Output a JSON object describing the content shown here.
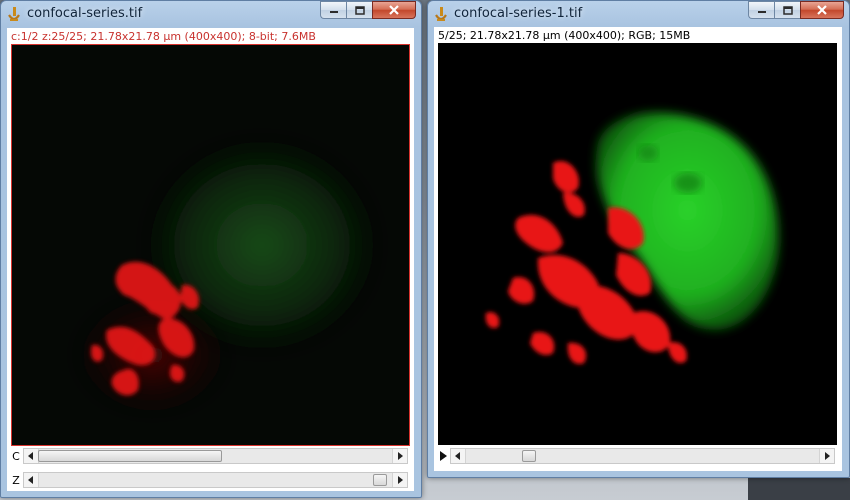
{
  "window_left": {
    "title": "confocal-series.tif",
    "info": "c:1/2 z:25/25; 21.78x21.78 µm (400x400); 8-bit; 7.6MB",
    "sliders": [
      {
        "label": "C",
        "position": 1,
        "count": 2
      },
      {
        "label": "Z",
        "position": 25,
        "count": 25
      }
    ]
  },
  "window_right": {
    "title": "confocal-series-1.tif",
    "info": "5/25; 21.78x21.78 µm (400x400); RGB; 15MB",
    "slider": {
      "position": 5,
      "count": 25
    }
  },
  "icons": {
    "app": "imagej-icon",
    "minimize": "minimize-icon",
    "maximize": "maximize-icon",
    "close": "close-icon",
    "play": "play-icon"
  },
  "colors": {
    "info_red": "#c8322e",
    "channel_red": "#ff1a1a",
    "channel_green": "#22cc22",
    "titlebar": "#b9d1ea",
    "close_button": "#c3472c"
  }
}
